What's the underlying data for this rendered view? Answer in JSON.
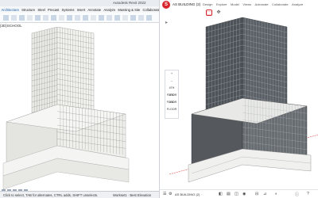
{
  "revit": {
    "title": "Autodesk Revit 2022",
    "tabs": [
      "Architecture",
      "Structure",
      "Steel",
      "Precast",
      "Systems",
      "Insert",
      "Annotate",
      "Analyze",
      "Massing & Site",
      "Collaborate"
    ],
    "tabs2": [
      "Modify",
      "Project Location",
      "Design Options",
      "Generative Design",
      "Manage Projects",
      "Phasing",
      "Selection",
      "Inquiry",
      "Macros"
    ],
    "view_label": "{3D}SCHOOL",
    "status_left": "Click to select, TAB for alternates, CTRL adds, SHIFT unselects.",
    "status_right": "Workset1 · Best Elevation"
  },
  "sketchup": {
    "logo": "S",
    "file_name": "AS BUILDING (2)",
    "menu": [
      "Design",
      "Explore",
      "Model",
      "Views",
      "Automate",
      "Collaborate",
      "Analyze"
    ],
    "nav": [
      "+",
      "–",
      "4TH FLOOR",
      "3RD FLOOR",
      "2ND FLOOR"
    ],
    "bottom_text": "AS BUILDING (2) ·"
  },
  "colors": {
    "revit_bg": "#ffffff",
    "su_accent": "#d7262e"
  },
  "icons": [
    "select-icon",
    "pan-icon",
    "orbit-icon",
    "zoom-icon",
    "section-icon",
    "measure-icon",
    "visibility-icon"
  ]
}
